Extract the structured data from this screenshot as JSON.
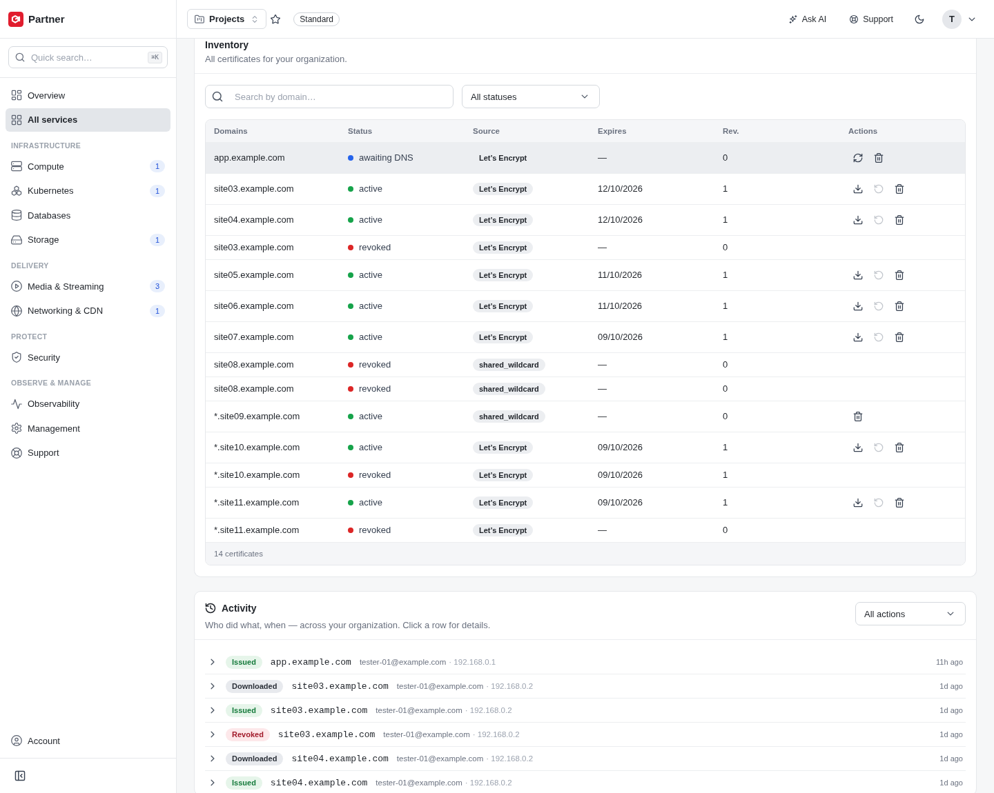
{
  "sidebar": {
    "brand": "Partner",
    "search": {
      "placeholder": "Quick search…",
      "shortcut": "⌘K"
    },
    "sections": [
      {
        "items": [
          {
            "kind": "overview",
            "label": "Overview",
            "selected": false
          },
          {
            "kind": "services",
            "label": "All services",
            "selected": true
          }
        ]
      },
      {
        "title": "INFRASTRUCTURE",
        "items": [
          {
            "kind": "compute",
            "label": "Compute",
            "badge": "1",
            "selected": false
          },
          {
            "kind": "kubernetes",
            "label": "Kubernetes",
            "badge": "1",
            "selected": false
          },
          {
            "kind": "databases",
            "label": "Databases",
            "selected": false
          },
          {
            "kind": "storage",
            "label": "Storage",
            "badge": "1",
            "selected": false
          }
        ]
      },
      {
        "title": "DELIVERY",
        "items": [
          {
            "kind": "media",
            "label": "Media & Streaming",
            "badge": "3",
            "selected": false
          },
          {
            "kind": "networking",
            "label": "Networking & CDN",
            "badge": "1",
            "selected": false
          }
        ]
      },
      {
        "title": "PROTECT",
        "items": [
          {
            "kind": "security",
            "label": "Security",
            "selected": false
          }
        ]
      },
      {
        "title": "OBSERVE & MANAGE",
        "items": [
          {
            "kind": "observability",
            "label": "Observability",
            "selected": false
          },
          {
            "kind": "management",
            "label": "Management",
            "selected": false
          },
          {
            "kind": "support",
            "label": "Support",
            "selected": false
          }
        ]
      }
    ],
    "footer_items": [
      {
        "kind": "account",
        "label": "Account",
        "selected": false
      }
    ]
  },
  "topbar": {
    "project_menu": "Projects",
    "plan": "Standard",
    "links": [
      {
        "kind": "ai",
        "label": "Ask AI"
      },
      {
        "kind": "support",
        "label": "Support"
      }
    ],
    "avatar": "T"
  },
  "inventory": {
    "title": "Inventory",
    "description": "All certificates for your organization.",
    "search": {
      "placeholder": "Search by domain…"
    },
    "status_filter": "All statuses",
    "table": {
      "columns": [
        "Domains",
        "Status",
        "Source",
        "Expires",
        "Rev.",
        "Actions"
      ],
      "rows": [
        {
          "domain": "app.example.com",
          "status": {
            "label": "awaiting DNS",
            "color": "#2563eb"
          },
          "source": "Let’s Encrypt",
          "expires": "—",
          "rev": "0",
          "selected": true,
          "actions": [
            {
              "kind": "retry",
              "disabled": false
            },
            {
              "kind": "delete",
              "disabled": false
            }
          ]
        },
        {
          "domain": "site03.example.com",
          "status": {
            "label": "active",
            "color": "#16a34a"
          },
          "source": "Let’s Encrypt",
          "expires": "12/10/2026",
          "rev": "1",
          "selected": false,
          "actions": [
            {
              "kind": "download",
              "disabled": false
            },
            {
              "kind": "renew",
              "disabled": true
            },
            {
              "kind": "delete",
              "disabled": false
            }
          ]
        },
        {
          "domain": "site04.example.com",
          "status": {
            "label": "active",
            "color": "#16a34a"
          },
          "source": "Let’s Encrypt",
          "expires": "12/10/2026",
          "rev": "1",
          "selected": false,
          "actions": [
            {
              "kind": "download",
              "disabled": false
            },
            {
              "kind": "renew",
              "disabled": true
            },
            {
              "kind": "delete",
              "disabled": false
            }
          ]
        },
        {
          "domain": "site03.example.com",
          "status": {
            "label": "revoked",
            "color": "#dc2626"
          },
          "source": "Let’s Encrypt",
          "expires": "—",
          "rev": "0",
          "selected": false,
          "actions": []
        },
        {
          "domain": "site05.example.com",
          "status": {
            "label": "active",
            "color": "#16a34a"
          },
          "source": "Let’s Encrypt",
          "expires": "11/10/2026",
          "rev": "1",
          "selected": false,
          "actions": [
            {
              "kind": "download",
              "disabled": false
            },
            {
              "kind": "renew",
              "disabled": true
            },
            {
              "kind": "delete",
              "disabled": false
            }
          ]
        },
        {
          "domain": "site06.example.com",
          "status": {
            "label": "active",
            "color": "#16a34a"
          },
          "source": "Let’s Encrypt",
          "expires": "11/10/2026",
          "rev": "1",
          "selected": false,
          "actions": [
            {
              "kind": "download",
              "disabled": false
            },
            {
              "kind": "renew",
              "disabled": true
            },
            {
              "kind": "delete",
              "disabled": false
            }
          ]
        },
        {
          "domain": "site07.example.com",
          "status": {
            "label": "active",
            "color": "#16a34a"
          },
          "source": "Let’s Encrypt",
          "expires": "09/10/2026",
          "rev": "1",
          "selected": false,
          "actions": [
            {
              "kind": "download",
              "disabled": false
            },
            {
              "kind": "renew",
              "disabled": true
            },
            {
              "kind": "delete",
              "disabled": false
            }
          ]
        },
        {
          "domain": "site08.example.com",
          "status": {
            "label": "revoked",
            "color": "#dc2626"
          },
          "source": "shared_wildcard",
          "expires": "—",
          "rev": "0",
          "selected": false,
          "actions": []
        },
        {
          "domain": "site08.example.com",
          "status": {
            "label": "revoked",
            "color": "#dc2626"
          },
          "source": "shared_wildcard",
          "expires": "—",
          "rev": "0",
          "selected": false,
          "actions": []
        },
        {
          "domain": "*.site09.example.com",
          "status": {
            "label": "active",
            "color": "#16a34a"
          },
          "source": "shared_wildcard",
          "expires": "—",
          "rev": "0",
          "selected": false,
          "actions": [
            {
              "kind": "delete",
              "disabled": false
            }
          ]
        },
        {
          "domain": "*.site10.example.com",
          "status": {
            "label": "active",
            "color": "#16a34a"
          },
          "source": "Let’s Encrypt",
          "expires": "09/10/2026",
          "rev": "1",
          "selected": false,
          "actions": [
            {
              "kind": "download",
              "disabled": false
            },
            {
              "kind": "renew",
              "disabled": true
            },
            {
              "kind": "delete",
              "disabled": false
            }
          ]
        },
        {
          "domain": "*.site10.example.com",
          "status": {
            "label": "revoked",
            "color": "#dc2626"
          },
          "source": "Let’s Encrypt",
          "expires": "09/10/2026",
          "rev": "1",
          "selected": false,
          "actions": []
        },
        {
          "domain": "*.site11.example.com",
          "status": {
            "label": "active",
            "color": "#16a34a"
          },
          "source": "Let’s Encrypt",
          "expires": "09/10/2026",
          "rev": "1",
          "selected": false,
          "actions": [
            {
              "kind": "download",
              "disabled": false
            },
            {
              "kind": "renew",
              "disabled": true
            },
            {
              "kind": "delete",
              "disabled": false
            }
          ]
        },
        {
          "domain": "*.site11.example.com",
          "status": {
            "label": "revoked",
            "color": "#dc2626"
          },
          "source": "Let’s Encrypt",
          "expires": "—",
          "rev": "0",
          "selected": false,
          "actions": []
        }
      ],
      "footer": "14 certificates"
    }
  },
  "activity": {
    "title": "Activity",
    "description": "Who did what, when — across your organization. Click a row for details.",
    "filter": "All actions",
    "rows": [
      {
        "kind": "issued",
        "label": "Issued",
        "domain": "app.example.com",
        "actor": "tester-01@example.com",
        "origin": "· 192.168.0.1",
        "time": "11h ago",
        "expanded": false
      },
      {
        "kind": "downloaded",
        "label": "Downloaded",
        "domain": "site03.example.com",
        "actor": "tester-01@example.com",
        "origin": "· 192.168.0.2",
        "time": "1d ago",
        "expanded": false
      },
      {
        "kind": "issued",
        "label": "Issued",
        "domain": "site03.example.com",
        "actor": "tester-01@example.com",
        "origin": "· 192.168.0.2",
        "time": "1d ago",
        "expanded": false
      },
      {
        "kind": "revoked",
        "label": "Revoked",
        "domain": "site03.example.com",
        "actor": "tester-01@example.com",
        "origin": "· 192.168.0.2",
        "time": "1d ago",
        "expanded": false
      },
      {
        "kind": "downloaded",
        "label": "Downloaded",
        "domain": "site04.example.com",
        "actor": "tester-01@example.com",
        "origin": "· 192.168.0.2",
        "time": "1d ago",
        "expanded": false
      },
      {
        "kind": "issued",
        "label": "Issued",
        "domain": "site04.example.com",
        "actor": "tester-01@example.com",
        "origin": "· 192.168.0.2",
        "time": "1d ago",
        "expanded": false
      }
    ]
  }
}
